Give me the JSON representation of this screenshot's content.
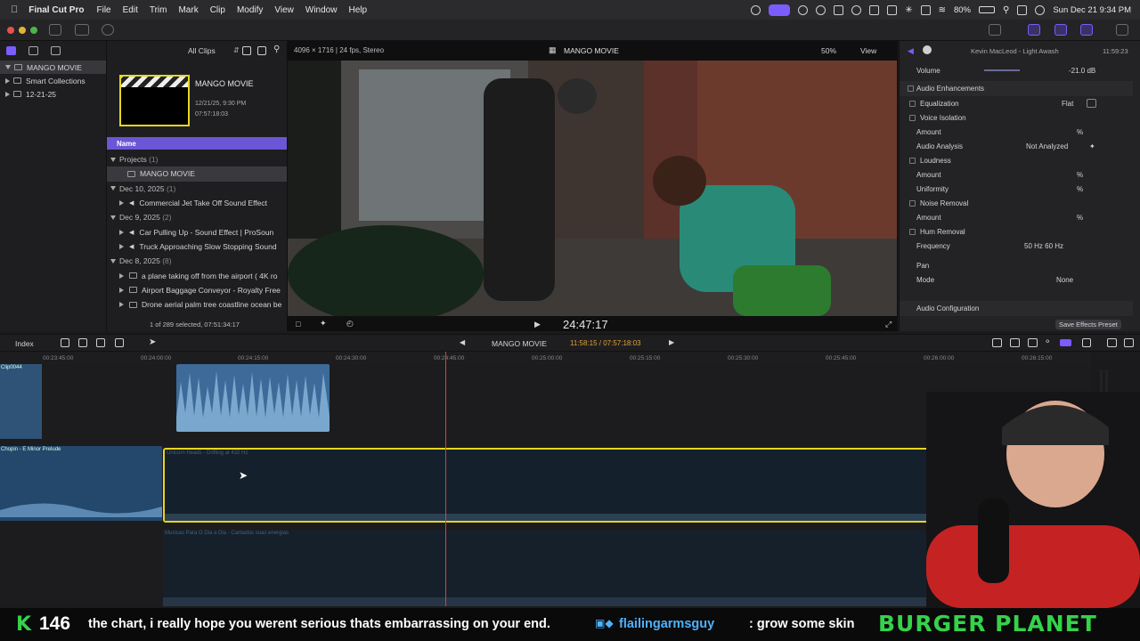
{
  "menubar": {
    "app_name": "Final Cut Pro",
    "menus": [
      "File",
      "Edit",
      "Trim",
      "Mark",
      "Clip",
      "Modify",
      "View",
      "Window",
      "Help"
    ],
    "battery": "80%",
    "clock": "Sun Dec 21  9:34 PM"
  },
  "sidebar": {
    "items": [
      {
        "label": "MANGO MOVIE"
      },
      {
        "label": "Smart Collections"
      },
      {
        "label": "12-21-25"
      }
    ]
  },
  "browser": {
    "filter": "All Clips",
    "project_card": {
      "title": "MANGO MOVIE",
      "date": "12/21/25, 9:30 PM",
      "duration": "07:57:18:03"
    },
    "column_header": "Name",
    "groups": [
      {
        "label": "Projects",
        "count": "(1)",
        "items": [
          "MANGO MOVIE"
        ]
      },
      {
        "label": "Dec 10, 2025",
        "count": "(1)",
        "items": [
          "Commercial Jet Take Off Sound Effect"
        ]
      },
      {
        "label": "Dec 9, 2025",
        "count": "(2)",
        "items": [
          "Car Pulling Up - Sound Effect  |  ProSoun",
          "Truck Approaching Slow Stopping Sound"
        ]
      },
      {
        "label": "Dec 8, 2025",
        "count": "(8)",
        "items": [
          "a plane taking off from the airport ( 4K ro",
          "Airport Baggage Conveyor - Royalty Free",
          "Drone aerial palm tree coastline ocean be"
        ]
      }
    ],
    "status": "1 of 289 selected, 07:51:34:17"
  },
  "viewer": {
    "format": "4096 × 1716 | 24 fps, Stereo",
    "title": "MANGO MOVIE",
    "zoom": "50%",
    "view": "View",
    "timecode": "24:47:17"
  },
  "inspector": {
    "clip_name": "Kevin MacLeod - Light Awash",
    "duration": "11:59:23",
    "volume_label": "Volume",
    "volume_value": "-21.0  dB",
    "section": "Audio Enhancements",
    "rows": [
      {
        "label": "Equalization",
        "value": "Flat",
        "checkbox": true
      },
      {
        "label": "Voice Isolation",
        "value": "",
        "checkbox": true
      },
      {
        "label": "Amount",
        "value": "%",
        "checkbox": false
      },
      {
        "label": "Audio Analysis",
        "value": "Not Analyzed",
        "checkbox": false
      },
      {
        "label": "Loudness",
        "value": "",
        "checkbox": true
      },
      {
        "label": "Amount",
        "value": "%",
        "checkbox": false
      },
      {
        "label": "Uniformity",
        "value": "%",
        "checkbox": false
      },
      {
        "label": "Noise Removal",
        "value": "",
        "checkbox": true
      },
      {
        "label": "Amount",
        "value": "%",
        "checkbox": false
      },
      {
        "label": "Hum Removal",
        "value": "",
        "checkbox": true
      },
      {
        "label": "Frequency",
        "value": "50 Hz      60 Hz",
        "checkbox": false
      }
    ],
    "pan_label": "Pan",
    "mode_label": "Mode",
    "mode_value": "None",
    "audio_config": "Audio Configuration",
    "save_preset": "Save Effects Preset"
  },
  "timeline": {
    "index": "Index",
    "project": "MANGO MOVIE",
    "timecode": "11:58:15 / 07:57:18:03",
    "ruler": [
      "00:23:45:00",
      "00:24:00:00",
      "00:24:15:00",
      "00:24:30:00",
      "00:24:45:00",
      "00:25:00:00",
      "00:25:15:00",
      "00:25:30:00",
      "00:25:45:00",
      "00:26:00:00",
      "00:26:15:00"
    ],
    "clips": {
      "clip_top_left": "Clip0044",
      "music_left": "Chopin - E Minor Prelude",
      "selected_clip": "Unicorn Heads - Drifting at 432 Hz",
      "lower_clip": "Musicas Para O Dia a Dia - Cantados suas energias"
    }
  },
  "stream": {
    "counter": "146",
    "message": "the chart, i really hope you werent serious thats embarrassing on your end.",
    "user": "flailingarmsguy",
    "user_message": ": grow some skin",
    "brand": "BURGER PLANET"
  },
  "colors": {
    "accent": "#7a5cff",
    "selection_yellow": "#e5d61f",
    "playhead": "#e23b3b",
    "audio_clip": "#3e6a9a",
    "brand_green": "#35d24a"
  }
}
